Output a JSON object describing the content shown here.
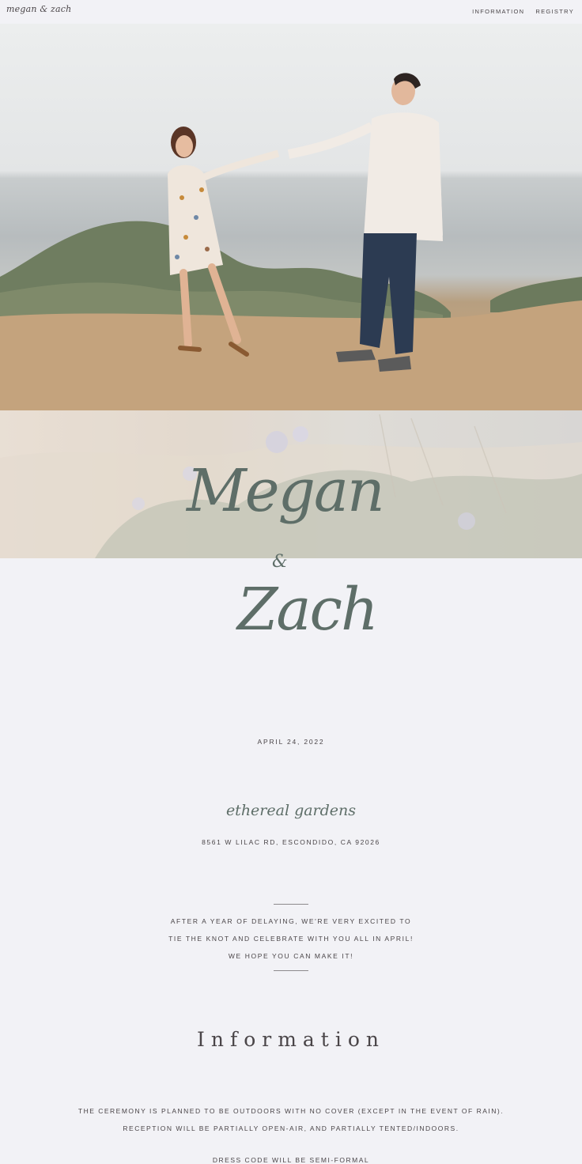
{
  "header": {
    "logo": "megan & zach",
    "nav": [
      "INFORMATION",
      "REGISTRY"
    ]
  },
  "names": {
    "first": "Megan",
    "ampersand": "&",
    "second": "Zach"
  },
  "event": {
    "date": "APRIL 24, 2022",
    "venue": "ethereal gardens",
    "address": "8561 W LILAC RD, ESCONDIDO, CA 92026"
  },
  "message": "AFTER A YEAR OF DELAYING, WE'RE VERY EXCITED TO TIE THE KNOT AND CELEBRATE WITH YOU ALL IN APRIL!  WE HOPE YOU CAN MAKE IT!",
  "information": {
    "title": "Information",
    "details": [
      "THE CEREMONY IS PLANNED TO BE OUTDOORS WITH NO COVER (EXCEPT IN THE EVENT OF RAIN).",
      "RECEPTION WILL BE PARTIALLY OPEN-AIR, AND PARTIALLY TENTED/INDOORS."
    ],
    "dress_code": "DRESS CODE WILL BE SEMI-FORMAL"
  }
}
